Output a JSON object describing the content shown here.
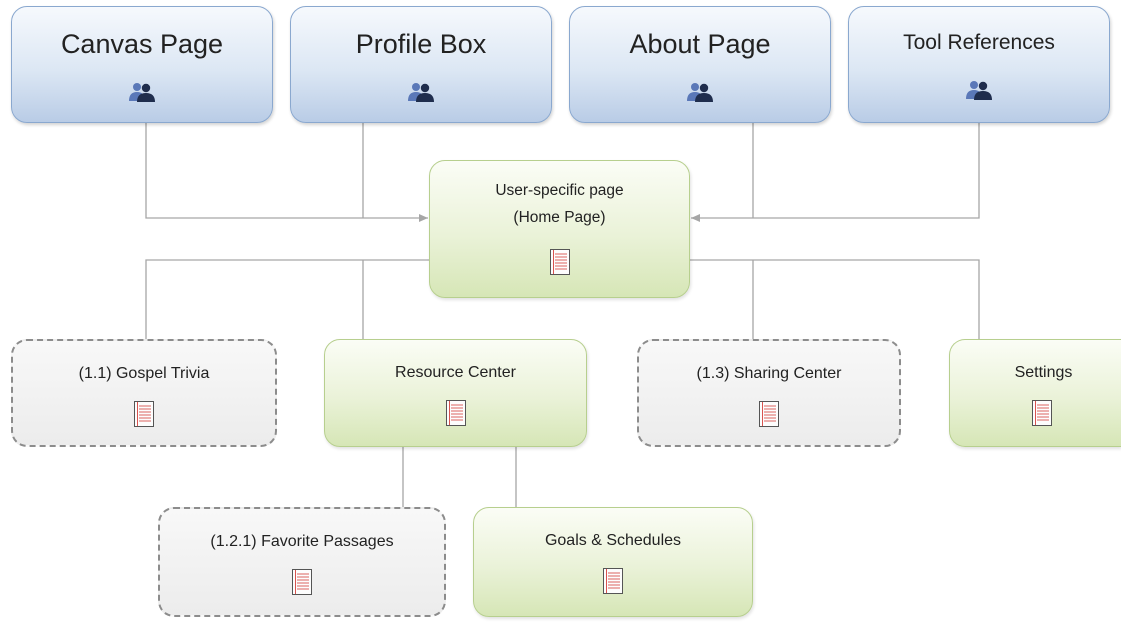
{
  "diagram": {
    "top_nodes": [
      {
        "label": "Canvas Page",
        "icon": "people-icon"
      },
      {
        "label": "Profile Box",
        "icon": "people-icon"
      },
      {
        "label": "About Page",
        "icon": "people-icon"
      },
      {
        "label": "Tool References",
        "icon": "people-icon"
      }
    ],
    "center_node": {
      "line1": "User-specific page",
      "line2": "(Home Page)",
      "icon": "page-icon"
    },
    "second_level": [
      {
        "label": "(1.1) Gospel Trivia",
        "style": "dashed",
        "icon": "page-icon"
      },
      {
        "label": "Resource Center",
        "style": "solid",
        "icon": "page-icon"
      },
      {
        "label": "(1.3) Sharing Center",
        "style": "dashed",
        "icon": "page-icon"
      },
      {
        "label": "Settings",
        "style": "solid",
        "icon": "page-icon"
      }
    ],
    "third_level": [
      {
        "label": "(1.2.1) Favorite Passages",
        "style": "dashed",
        "icon": "page-icon"
      },
      {
        "label": "Goals & Schedules",
        "style": "solid",
        "icon": "page-icon"
      }
    ],
    "colors": {
      "blue_border": "#8aa8cf",
      "green_border": "#b7cf8e",
      "dashed_border": "#8c8c8c",
      "connector": "#a6a6a6",
      "people_front": "#1f2d4d",
      "people_back": "#5a78b8",
      "page_lines": "#d9534f"
    }
  }
}
